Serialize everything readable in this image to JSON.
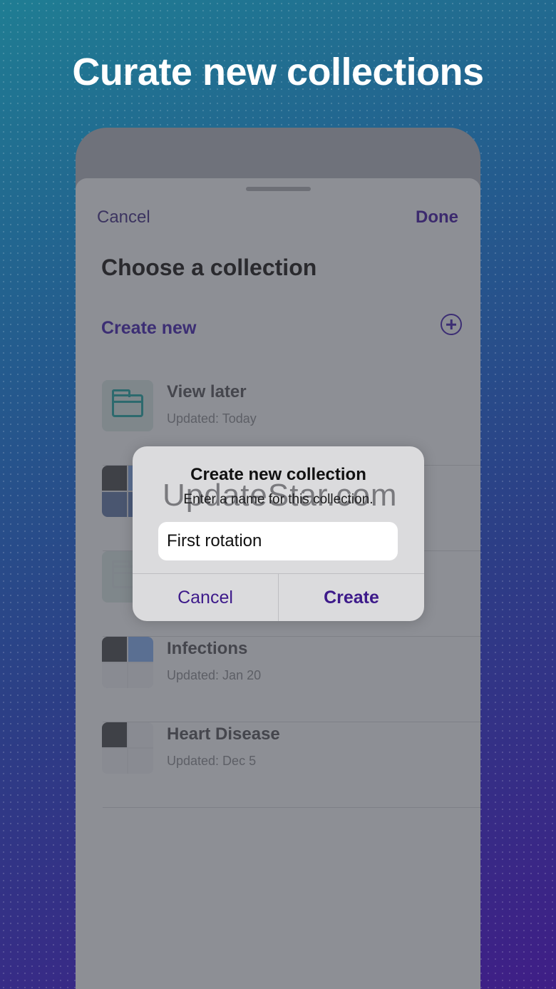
{
  "headline": "Curate new collections",
  "sheet": {
    "cancel_label": "Cancel",
    "done_label": "Done",
    "title": "Choose a collection",
    "create_new_label": "Create new",
    "items": [
      {
        "name": "View later",
        "updated": "Updated: Today"
      },
      {
        "name": "Infections",
        "updated": "Updated: Jan 20"
      },
      {
        "name": "Heart Disease",
        "updated": "Updated: Dec 5"
      }
    ]
  },
  "dialog": {
    "title": "Create new collection",
    "message": "Enter a name for this collection.",
    "input_value": "First rotation",
    "cancel_label": "Cancel",
    "create_label": "Create"
  },
  "watermark": "UpdateStar.com",
  "colors": {
    "accent": "#3d1a8a",
    "background_start": "#1f7d93",
    "background_end": "#3f1e86",
    "folder_icon": "#2d6a6e"
  }
}
